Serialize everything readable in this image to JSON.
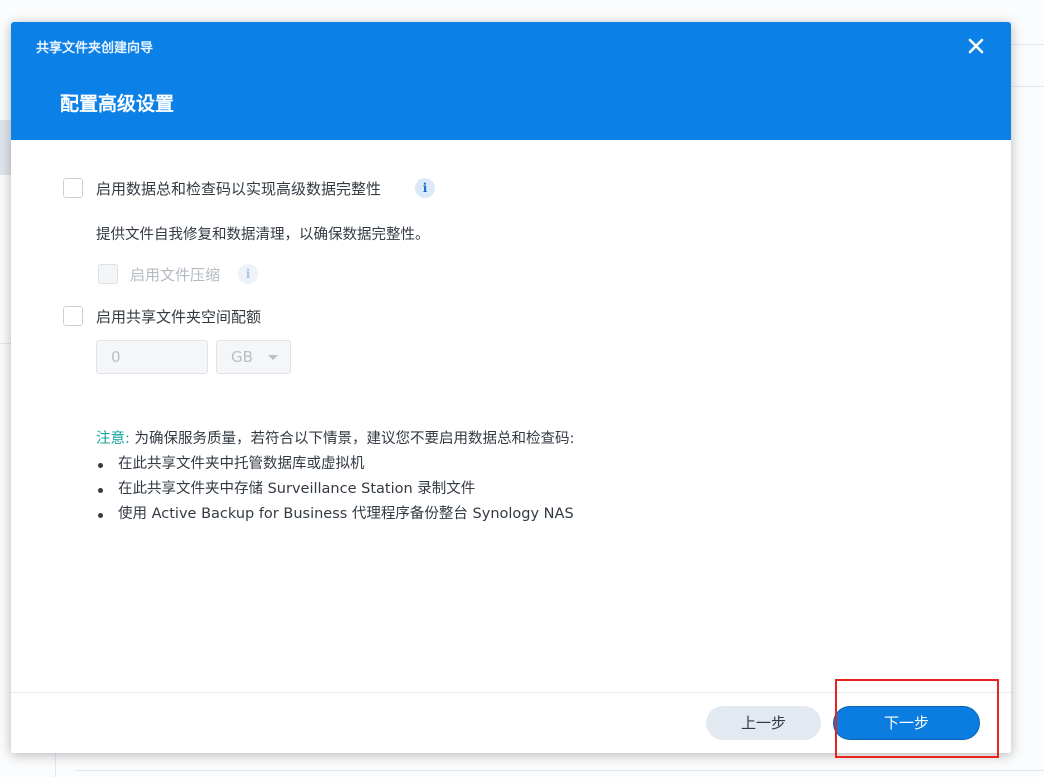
{
  "dialog": {
    "wizard_title": "共享文件夹创建向导",
    "step_title": "配置高级设置"
  },
  "options": {
    "checksum_label": "启用数据总和检查码以实现高级数据完整性",
    "checksum_desc": "提供文件自我修复和数据清理，以确保数据完整性。",
    "compression_label": "启用文件压缩",
    "quota_label": "启用共享文件夹空间配额",
    "quota_value": "0",
    "quota_unit": "GB"
  },
  "note": {
    "label": "注意:",
    "text": "为确保服务质量，若符合以下情景，建议您不要启用数据总和检查码:",
    "items": [
      "在此共享文件夹中托管数据库或虚拟机",
      "在此共享文件夹中存储 Surveillance Station 录制文件",
      "使用 Active Backup for Business 代理程序备份整台 Synology NAS"
    ]
  },
  "footer": {
    "prev_label": "上一步",
    "next_label": "下一步"
  },
  "icons": {
    "close": "close-icon",
    "info": "info-icon",
    "select_caret": "chevron-down-icon"
  },
  "colors": {
    "header": "#0b81e8",
    "primary_button": "#0b7ce0",
    "note_label": "#0fa39b",
    "highlight": "#e8241c"
  }
}
